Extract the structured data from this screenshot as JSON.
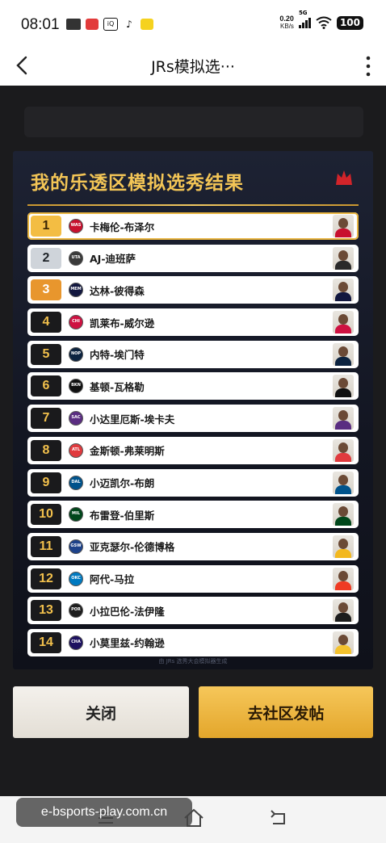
{
  "status_bar": {
    "time": "08:01",
    "net_speed_value": "0.20",
    "net_speed_unit": "KB/s",
    "network": "5G",
    "battery": "100"
  },
  "nav": {
    "title": "JRs模拟选···"
  },
  "card": {
    "title": "我的乐透区模拟选秀结果",
    "footer_note": "由 JRs 选秀大会模拟器生成",
    "picks": [
      {
        "pick": "1",
        "player": "卡梅伦-布泽尔",
        "team": "WAS",
        "team_color": "#c8102e"
      },
      {
        "pick": "2",
        "player": "AJ-迪班萨",
        "team": "UTA",
        "team_color": "#3a3a3a"
      },
      {
        "pick": "3",
        "player": "达林-彼得森",
        "team": "MEM",
        "team_color": "#12173f"
      },
      {
        "pick": "4",
        "player": "凯莱布-威尔逊",
        "team": "CHI",
        "team_color": "#ce1141"
      },
      {
        "pick": "5",
        "player": "内特-埃门特",
        "team": "NOP",
        "team_color": "#0c2340"
      },
      {
        "pick": "6",
        "player": "基顿-瓦格勒",
        "team": "BKN",
        "team_color": "#111111"
      },
      {
        "pick": "7",
        "player": "小达里厄斯-埃卡夫",
        "team": "SAC",
        "team_color": "#5a2d81"
      },
      {
        "pick": "8",
        "player": "金斯顿-弗莱明斯",
        "team": "ATL",
        "team_color": "#e03a3e"
      },
      {
        "pick": "9",
        "player": "小迈凯尔-布朗",
        "team": "DAL",
        "team_color": "#00538c"
      },
      {
        "pick": "10",
        "player": "布雷登-伯里斯",
        "team": "MIL",
        "team_color": "#00471b"
      },
      {
        "pick": "11",
        "player": "亚克瑟尔-伦德博格",
        "team": "GSW",
        "team_color": "#1d428a"
      },
      {
        "pick": "12",
        "player": "阿代-马拉",
        "team": "OKC",
        "team_color": "#007ac1"
      },
      {
        "pick": "13",
        "player": "小拉巴伦-法伊隆",
        "team": "POR",
        "team_color": "#1d1d1d"
      },
      {
        "pick": "14",
        "player": "小莫里兹-约翰逊",
        "team": "CHA",
        "team_color": "#1d1160"
      }
    ]
  },
  "buttons": {
    "close": "关闭",
    "post": "去社区发帖"
  },
  "watermark": "e-bsports-play.com.cn",
  "colors": {
    "gold": "#f3c556",
    "card_bg": "#131622",
    "dark_bg": "#1b1b1d"
  }
}
